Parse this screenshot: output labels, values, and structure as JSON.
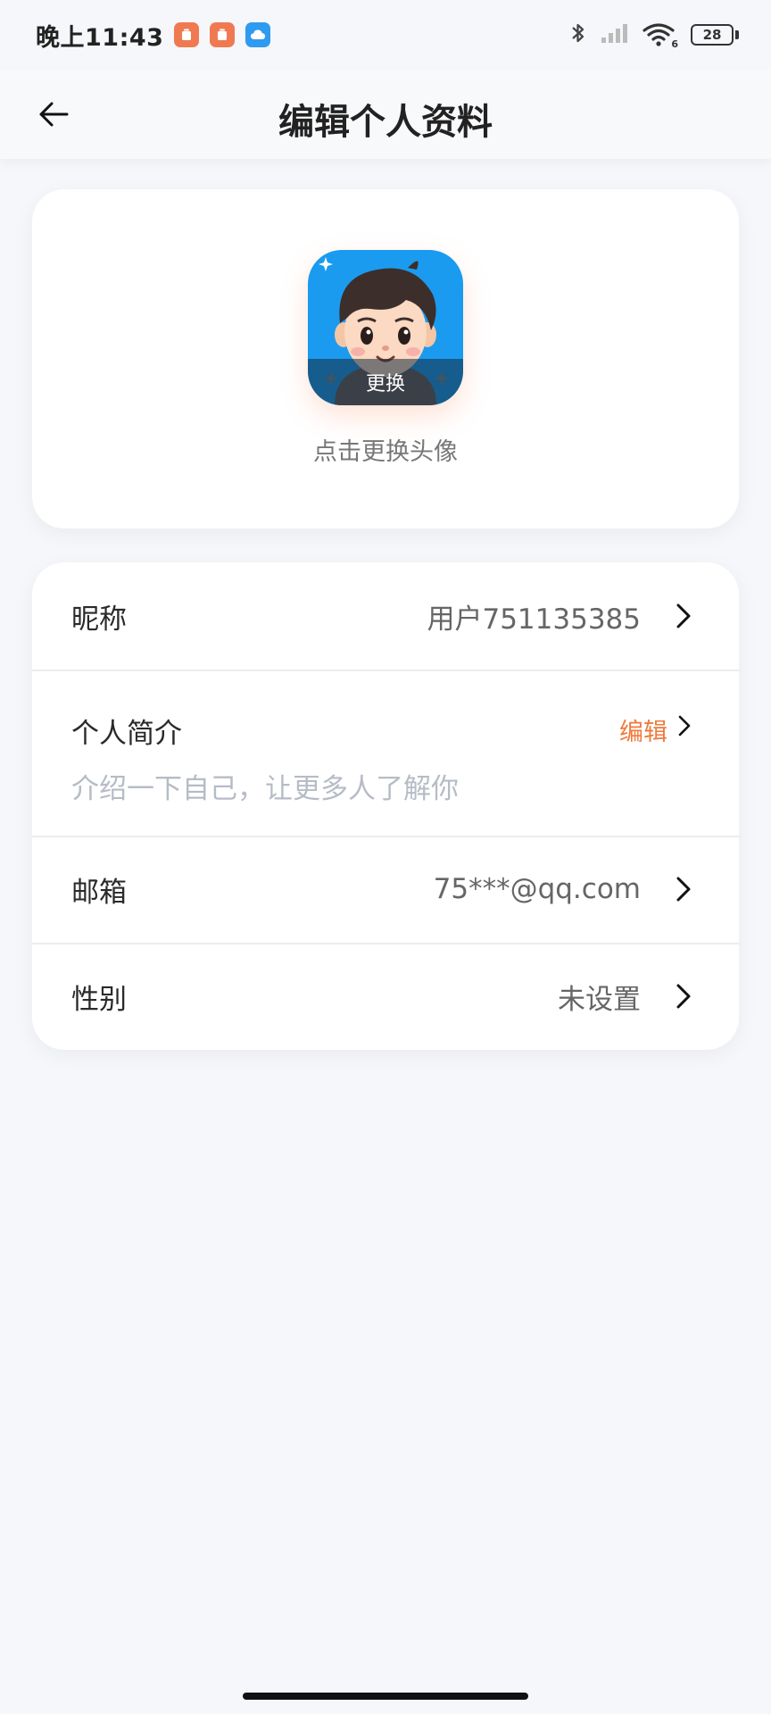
{
  "status_bar": {
    "time": "晚上11:43",
    "battery": "28",
    "wifi_badge": "6"
  },
  "header": {
    "title": "编辑个人资料"
  },
  "avatar_section": {
    "change_label": "更换",
    "hint": "点击更换头像"
  },
  "profile": {
    "nickname": {
      "label": "昵称",
      "value": "用户751135385"
    },
    "bio": {
      "label": "个人简介",
      "action": "编辑",
      "placeholder": "介绍一下自己，让更多人了解你"
    },
    "email": {
      "label": "邮箱",
      "value": "75***@qq.com"
    },
    "gender": {
      "label": "性别",
      "value": "未设置"
    }
  },
  "colors": {
    "accent": "#ef7a3c",
    "background": "#f6f7fa",
    "avatar_bg": "#1a9bf0"
  }
}
